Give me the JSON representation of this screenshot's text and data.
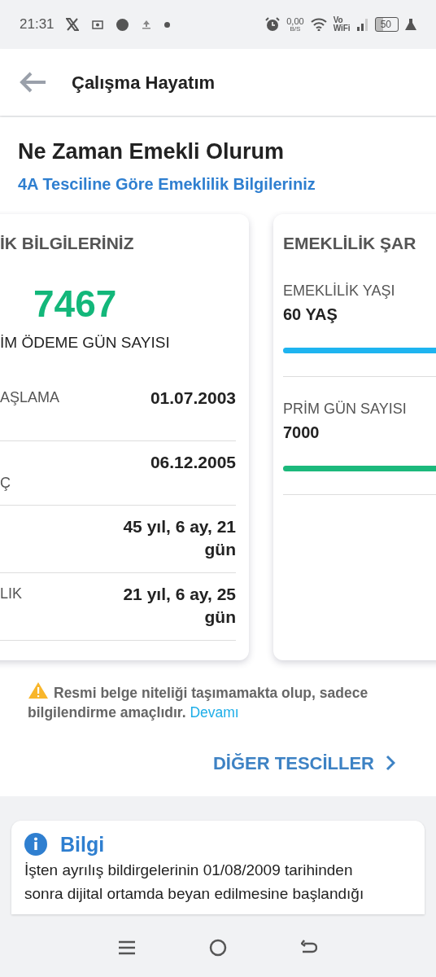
{
  "status_bar": {
    "time": "21:31",
    "speed": "0,00",
    "speed_unit": "B/S",
    "volte_top": "Vo",
    "volte_bottom": "WiFi",
    "battery": "50"
  },
  "app_bar": {
    "title": "Çalışma Hayatım"
  },
  "header": {
    "title": "Ne Zaman Emekli Olurum",
    "subtitle": "4A Tesciline Göre Emeklilik Bilgileriniz"
  },
  "info_card": {
    "title": "İK BİLGİLERİNİZ",
    "big_number": "7467",
    "big_label": "İM ÖDEME GÜN SAYISI",
    "rows": [
      {
        "label": "AŞLAMA",
        "value": "01.07.2003"
      },
      {
        "label": "Ç",
        "kind": "lower",
        "value": "06.12.2005"
      },
      {
        "value": "45 yıl, 6 ay, 21 gün"
      },
      {
        "label": "LIK",
        "value": "21 yıl, 6 ay, 25 gün"
      }
    ]
  },
  "conditions_card": {
    "title": "EMEKLİLİK ŞAR",
    "items": [
      {
        "label": "EMEKLİLİK YAŞI",
        "value": "60 YAŞ",
        "level": 1,
        "color": "#1eb4f0"
      },
      {
        "label": "PRİM GÜN SAYISI",
        "value": "7000",
        "level": 1,
        "color": "#1cb97c"
      }
    ]
  },
  "notice": {
    "text": "Resmi belge niteliği taşımamakta olup, sadece bilgilendirme amaçlıdır.",
    "link": "Devamı"
  },
  "other_link": "DİĞER TESCİLLER",
  "bilgi": {
    "title": "Bilgi",
    "text": "İşten ayrılış bildirgelerinin 01/08/2009 tarihinden sonra dijital ortamda beyan edilmesine başlandığı"
  }
}
